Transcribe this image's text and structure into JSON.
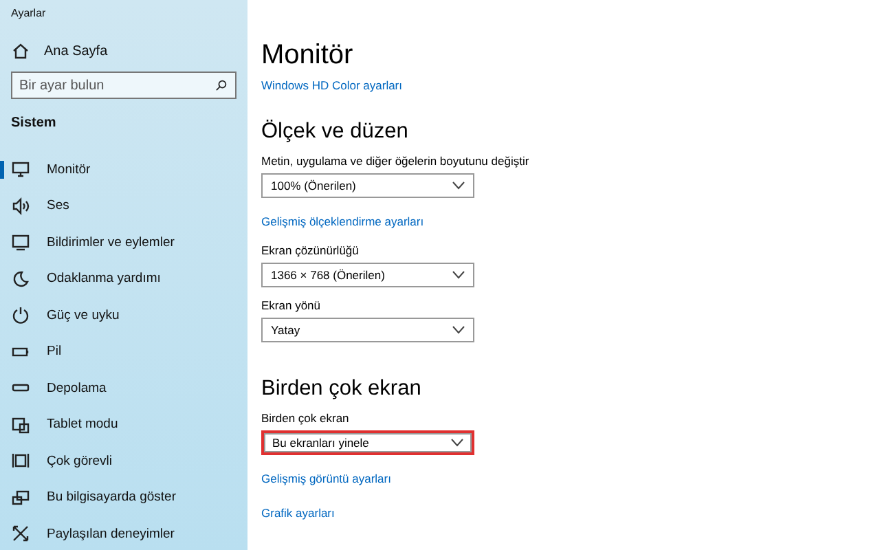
{
  "window": {
    "title": "Ayarlar"
  },
  "sidebar": {
    "home": "Ana Sayfa",
    "search": {
      "placeholder": "Bir ayar bulun"
    },
    "section": "Sistem",
    "items": [
      {
        "label": "Monitör",
        "selected": true
      },
      {
        "label": "Ses",
        "selected": false
      },
      {
        "label": "Bildirimler ve eylemler",
        "selected": false
      },
      {
        "label": "Odaklanma yardımı",
        "selected": false
      },
      {
        "label": "Güç ve uyku",
        "selected": false
      },
      {
        "label": "Pil",
        "selected": false
      },
      {
        "label": "Depolama",
        "selected": false
      },
      {
        "label": "Tablet modu",
        "selected": false
      },
      {
        "label": "Çok görevli",
        "selected": false
      },
      {
        "label": "Bu bilgisayarda göster",
        "selected": false
      },
      {
        "label": "Paylaşılan deneyimler",
        "selected": false
      }
    ]
  },
  "main": {
    "title": "Monitör",
    "link": "Windows HD Color ayarları",
    "sections": [
      {
        "heading": "Ölçek ve düzen",
        "items": [
          {
            "kind": "dropdown",
            "label": "Metin, uygulama ve diğer öğelerin boyutunu değiştir",
            "value": "100% (Önerilen)",
            "highlighted": false
          },
          {
            "kind": "link",
            "label": "Gelişmiş ölçeklendirme ayarları"
          },
          {
            "kind": "dropdown",
            "label": "Ekran çözünürlüğü",
            "value": "1366 × 768 (Önerilen)",
            "highlighted": false
          },
          {
            "kind": "dropdown",
            "label": "Ekran yönü",
            "value": "Yatay",
            "highlighted": false
          }
        ]
      },
      {
        "heading": "Birden çok ekran",
        "items": [
          {
            "kind": "dropdown",
            "label": "Birden çok ekran",
            "value": "Bu ekranları yinele",
            "highlighted": true
          },
          {
            "kind": "link",
            "label": "Gelişmiş görüntü ayarları"
          },
          {
            "kind": "link",
            "label": "Grafik ayarları"
          }
        ]
      }
    ]
  }
}
